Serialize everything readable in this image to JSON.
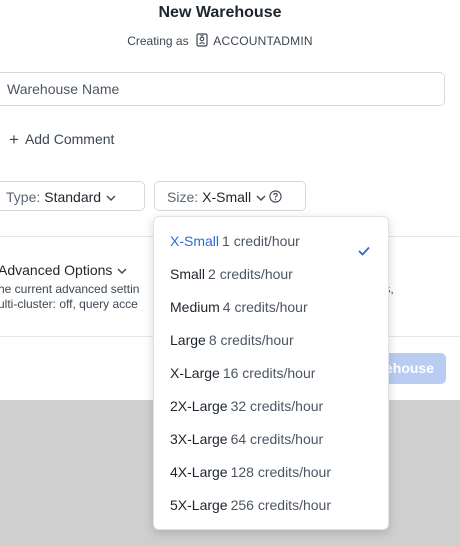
{
  "modal": {
    "title": "New Warehouse",
    "subtitle_prefix": "Creating as",
    "role": "ACCOUNTADMIN",
    "name_placeholder": "Warehouse Name",
    "add_comment": "Add Comment",
    "type_label": "Type:",
    "type_value": "Standard",
    "size_label": "Size:",
    "size_value": "X-Small",
    "advanced_title": "Advanced Options",
    "advanced_line1": "he current advanced settin",
    "advanced_line1_tail": "mins,",
    "advanced_line2": "ulti-cluster: off, query acce",
    "create_button": "Create Warehouse",
    "create_button_visible": "ehouse"
  },
  "size_options": [
    {
      "name": "X-Small",
      "credits": "1 credit/hour",
      "selected": true
    },
    {
      "name": "Small",
      "credits": "2 credits/hour",
      "selected": false
    },
    {
      "name": "Medium",
      "credits": "4 credits/hour",
      "selected": false
    },
    {
      "name": "Large",
      "credits": "8 credits/hour",
      "selected": false
    },
    {
      "name": "X-Large",
      "credits": "16 credits/hour",
      "selected": false
    },
    {
      "name": "2X-Large",
      "credits": "32 credits/hour",
      "selected": false
    },
    {
      "name": "3X-Large",
      "credits": "64 credits/hour",
      "selected": false
    },
    {
      "name": "4X-Large",
      "credits": "128 credits/hour",
      "selected": false
    },
    {
      "name": "5X-Large",
      "credits": "256 credits/hour",
      "selected": false
    }
  ],
  "colors": {
    "accent": "#2a6bd9",
    "overlay": "#cfcfcf",
    "disabled_button": "#b9cdf3"
  }
}
